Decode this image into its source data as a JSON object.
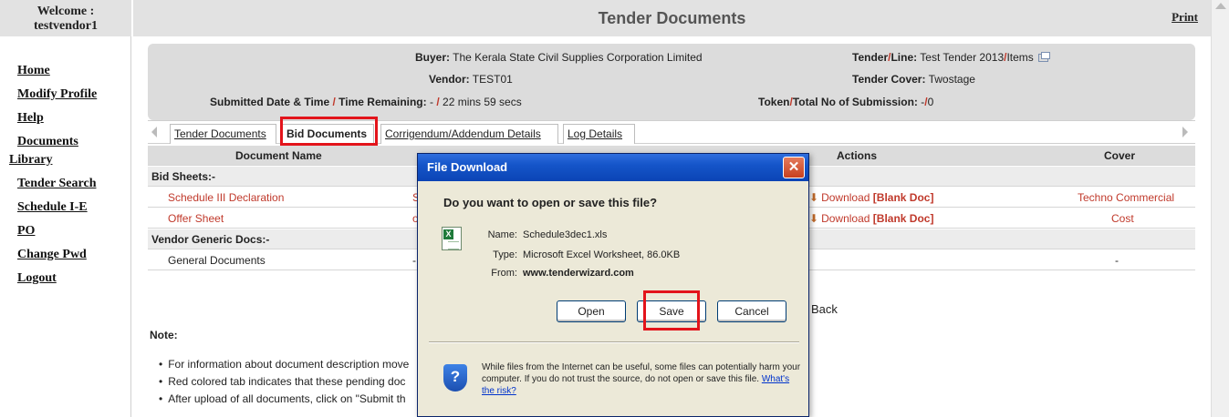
{
  "sidebar": {
    "welcome_label": "Welcome :",
    "username": "testvendor1",
    "items": [
      {
        "label": "Home"
      },
      {
        "label": "Modify Profile"
      },
      {
        "label": "Help"
      },
      {
        "label": "Documents"
      },
      {
        "label": "Library"
      },
      {
        "label": "Tender Search"
      },
      {
        "label": "Schedule I-E"
      },
      {
        "label": "PO"
      },
      {
        "label": "Change Pwd"
      },
      {
        "label": "Logout"
      }
    ]
  },
  "header": {
    "title": "Tender Documents",
    "print_label": "Print"
  },
  "info": {
    "buyer_label": "Buyer:",
    "buyer_value": "The Kerala State Civil Supplies Corporation Limited",
    "vendor_label": "Vendor:",
    "vendor_value": "TEST01",
    "submitted_label_a": "Submitted Date & Time",
    "submitted_label_b": "Time Remaining:",
    "submitted_value_a": "-",
    "submitted_value_b": "22 mins 59 secs",
    "tender_label_a": "Tender",
    "tender_label_b": "Line:",
    "tender_value_a": "Test Tender 2013",
    "tender_value_b": "Items",
    "cover_label": "Tender Cover:",
    "cover_value": "Twostage",
    "token_label_a": "Token",
    "token_label_b": "Total No of Submission:",
    "token_value_a": "-",
    "token_value_b": "0",
    "slash": "/"
  },
  "tabs": [
    {
      "label": "Tender Documents"
    },
    {
      "label": "Bid Documents"
    },
    {
      "label": "Corrigendum/Addendum Details"
    },
    {
      "label": "Log Details"
    }
  ],
  "table": {
    "headers": {
      "document_name": "Document Name",
      "actions": "Actions",
      "cover": "Cover"
    },
    "section_bid_sheets": "Bid Sheets:-",
    "rows": [
      {
        "name": "Schedule III Declaration",
        "file": "Sc",
        "action_prefix": "Download",
        "action_bracket": "[Blank Doc]",
        "cover": "Techno Commercial"
      },
      {
        "name": "Offer Sheet",
        "file": "off",
        "action_prefix": "Download",
        "action_bracket": "[Blank Doc]",
        "cover": "Cost"
      }
    ],
    "section_vendor_generic": "Vendor Generic Docs:-",
    "generic_row": {
      "name": "General Documents",
      "file": "-",
      "cover": "-"
    }
  },
  "back_label": "Back",
  "notes": {
    "title": "Note:",
    "items": [
      "For information about document description move",
      "Red colored tab indicates that these pending doc",
      "After upload of all documents, click on \"Submit th"
    ]
  },
  "dialog": {
    "title": "File Download",
    "close_glyph": "✕",
    "question": "Do you want to open or save this file?",
    "name_label": "Name:",
    "name_value": "Schedule3dec1.xls",
    "type_label": "Type:",
    "type_value": "Microsoft Excel Worksheet, 86.0KB",
    "from_label": "From:",
    "from_value": "www.tenderwizard.com",
    "open_label": "Open",
    "save_label": "Save",
    "cancel_label": "Cancel",
    "warning_text": "While files from the Internet can be useful, some files can potentially harm your computer. If you do not trust the source, do not open or save this file.",
    "risk_link": "What's the risk?"
  },
  "colors": {
    "highlight": "#e3141b",
    "link_red": "#c0392b",
    "dialog_titlebar": "#1555c9"
  }
}
